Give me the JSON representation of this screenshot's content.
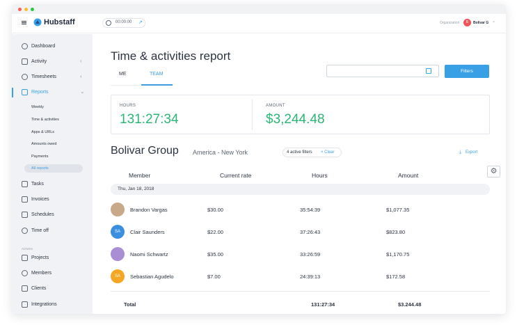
{
  "app": {
    "name": "Hubstaff",
    "timer": "00:00:00",
    "org_label": "Organization",
    "org_user": "Bolivar G",
    "org_avatar": "B"
  },
  "sidebar": {
    "items": [
      {
        "label": "Dashboard"
      },
      {
        "label": "Activity"
      },
      {
        "label": "Timesheets"
      },
      {
        "label": "Reports"
      },
      {
        "label": "Tasks"
      },
      {
        "label": "Invoices"
      },
      {
        "label": "Schedules"
      },
      {
        "label": "Time off"
      }
    ],
    "report_subitems": [
      "Weekly",
      "Time & activities",
      "Apps & URLs",
      "Amounts owed",
      "Payments",
      "All reports"
    ],
    "admin_label": "ADMIN",
    "admin_items": [
      {
        "label": "Projects"
      },
      {
        "label": "Members"
      },
      {
        "label": "Clients"
      },
      {
        "label": "Integrations"
      }
    ]
  },
  "page": {
    "title": "Time & activities report",
    "tabs": [
      "ME",
      "TEAM"
    ],
    "active_tab": "TEAM",
    "filters_label": "Filters"
  },
  "summary": {
    "hours_label": "HOURS",
    "hours_value": "131:27:34",
    "amount_label": "AMOUNT",
    "amount_value": "$3,244.48"
  },
  "group": {
    "title": "Bolivar Group",
    "location": "America - New York",
    "filters_chip": "4 active filters",
    "clear_label": "Clear",
    "export_label": "Export"
  },
  "table": {
    "headers": [
      "Member",
      "Current rate",
      "Hours",
      "Amount"
    ],
    "date": "Thu, Jan 18, 2018",
    "rows": [
      {
        "name": "Brandon Vargas",
        "rate": "$30.00",
        "hours": "35:54:39",
        "amount": "$1,077.35",
        "initials": "",
        "avatar_color": "#c9a98a"
      },
      {
        "name": "Clair Saunders",
        "rate": "$22.00",
        "hours": "37:26:43",
        "amount": "$823.80",
        "initials": "SA",
        "avatar_color": "#3a8fe0"
      },
      {
        "name": "Naomi Schwartz",
        "rate": "$35.00",
        "hours": "33:26:59",
        "amount": "$1,170.75",
        "initials": "",
        "avatar_color": "#a98ed6"
      },
      {
        "name": "Sebastian Agudelo",
        "rate": "$7.00",
        "hours": "24:39:13",
        "amount": "$172.58",
        "initials": "SA",
        "avatar_color": "#f5a623"
      }
    ],
    "total_label": "Total",
    "total_hours": "131:27:34",
    "total_amount": "$3.244.48"
  },
  "colors": {
    "accent": "#3aa0e6",
    "positive": "#2bb673",
    "sidebar_bg": "#f1f2f5"
  }
}
